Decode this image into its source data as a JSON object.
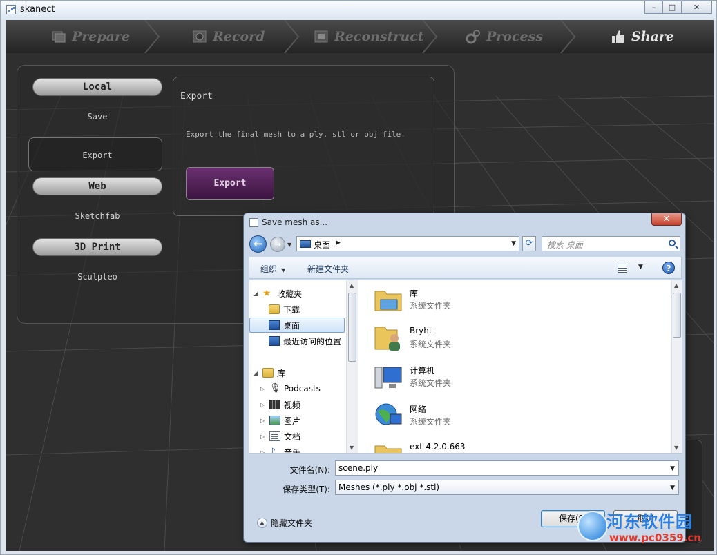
{
  "window": {
    "title": "skanect",
    "controls": [
      "–",
      "□",
      "✕"
    ]
  },
  "tabs": [
    {
      "label": "Prepare",
      "icon": "photos-icon"
    },
    {
      "label": "Record",
      "icon": "film-reel-icon"
    },
    {
      "label": "Reconstruct",
      "icon": "film-strip-icon"
    },
    {
      "label": "Process",
      "icon": "gears-icon"
    },
    {
      "label": "Share",
      "icon": "thumbs-up-icon"
    }
  ],
  "share_panel": {
    "local_label": "Local",
    "save_label": "Save",
    "export_label": "Export",
    "web_label": "Web",
    "sketchfab_label": "Sketchfab",
    "print_label": "3D Print",
    "sculpteo_label": "Sculpteo"
  },
  "export_panel": {
    "title": "Export",
    "description": "Export the final mesh to a ply, stl or obj file.",
    "button": "Export"
  },
  "dialog": {
    "title": "Save mesh as...",
    "close": "✕",
    "address": "桌面",
    "search_placeholder": "搜索 桌面",
    "organize": "组织",
    "new_folder": "新建文件夹",
    "help": "?",
    "tree": [
      {
        "label": "收藏夹",
        "icon": "star-icon",
        "level": 0
      },
      {
        "label": "下载",
        "icon": "download-folder-icon",
        "level": 1
      },
      {
        "label": "桌面",
        "icon": "desktop-icon",
        "level": 1,
        "selected": true
      },
      {
        "label": "最近访问的位置",
        "icon": "recent-places-icon",
        "level": 1
      },
      {
        "label": "库",
        "icon": "library-icon",
        "level": 0
      },
      {
        "label": "Podcasts",
        "icon": "podcast-icon",
        "level": 1
      },
      {
        "label": "视频",
        "icon": "video-icon",
        "level": 1
      },
      {
        "label": "图片",
        "icon": "pictures-icon",
        "level": 1
      },
      {
        "label": "文档",
        "icon": "documents-icon",
        "level": 1
      },
      {
        "label": "音乐",
        "icon": "music-icon",
        "level": 1
      }
    ],
    "files": [
      {
        "name": "库",
        "type": "系统文件夹",
        "icon": "library-icon"
      },
      {
        "name": "Bryht",
        "type": "系统文件夹",
        "icon": "user-folder-icon"
      },
      {
        "name": "计算机",
        "type": "系统文件夹",
        "icon": "computer-icon"
      },
      {
        "name": "网络",
        "type": "系统文件夹",
        "icon": "network-icon"
      },
      {
        "name": "ext-4.2.0.663",
        "type": "",
        "icon": "folder-icon"
      }
    ],
    "filename_label": "文件名(N):",
    "filename_value": "scene.ply",
    "filetype_label": "保存类型(T):",
    "filetype_value": "Meshes (*.ply *.obj *.stl)",
    "hide_folders": "隐藏文件夹",
    "save_button": "保存(S)",
    "cancel_button": "取消"
  },
  "watermark": {
    "text": "河东软件园",
    "url": "www.pc0359.cn"
  },
  "colors": {
    "export_button": "#5a2462",
    "dialog_frame": "#c9d7e8",
    "selected": "#cfe3f9"
  }
}
